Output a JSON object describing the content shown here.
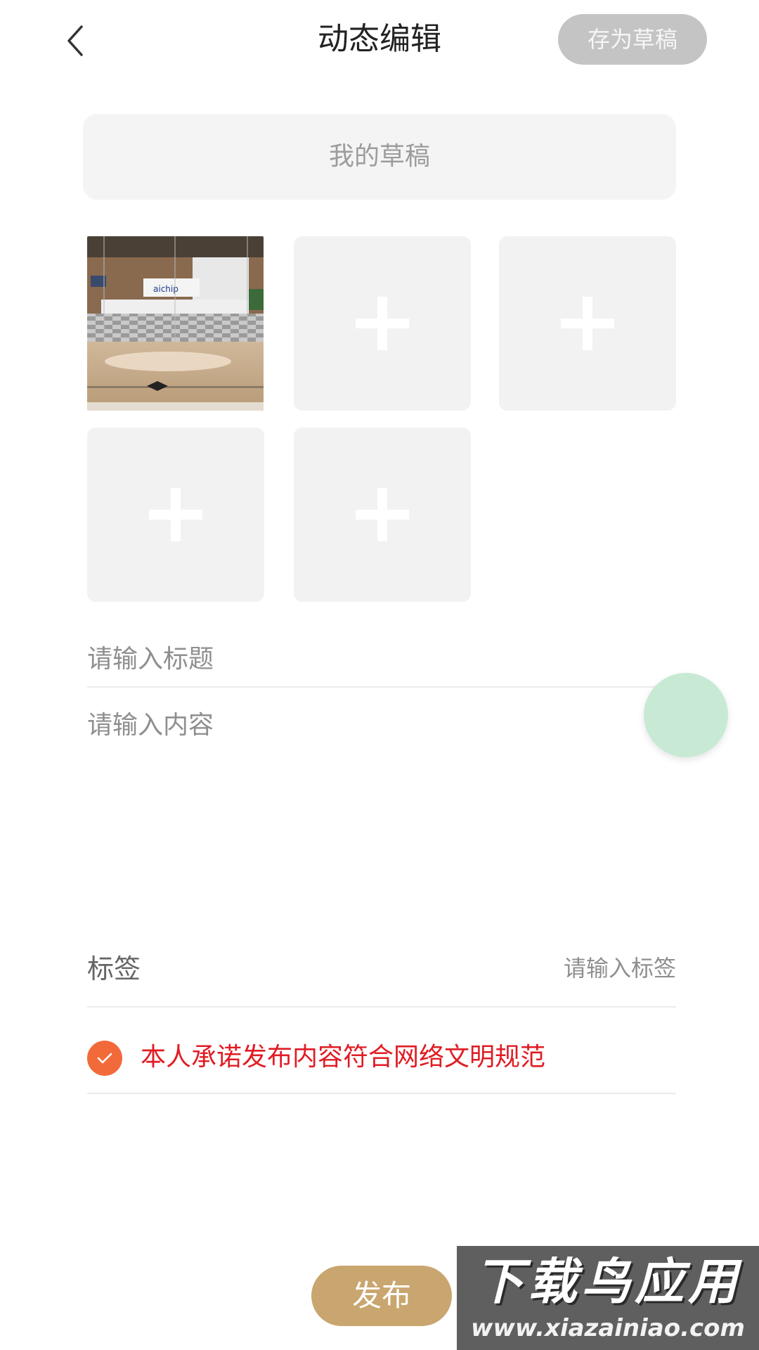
{
  "header": {
    "title": "动态编辑",
    "save_draft_label": "存为草稿",
    "back_icon": "chevron-left-icon"
  },
  "drafts": {
    "label": "我的草稿"
  },
  "photos": {
    "add_icon": "plus-icon",
    "thumbnail_sign_text": "aichip"
  },
  "form": {
    "title_placeholder": "请输入标题",
    "content_placeholder": "请输入内容",
    "tags_label": "标签",
    "tags_placeholder": "请输入标签"
  },
  "agreement": {
    "checked": true,
    "text": "本人承诺发布内容符合网络文明规范"
  },
  "actions": {
    "publish_label": "发布"
  },
  "watermark": {
    "title": "下载鸟应用",
    "url": "www.xiazainiao.com"
  },
  "colors": {
    "accent_publish": "#c9a66f",
    "check_orange": "#f26a3a",
    "agreement_red": "#e01c24",
    "save_draft_gray": "#c4c4c4",
    "floating_circle": "#c8ead4"
  }
}
